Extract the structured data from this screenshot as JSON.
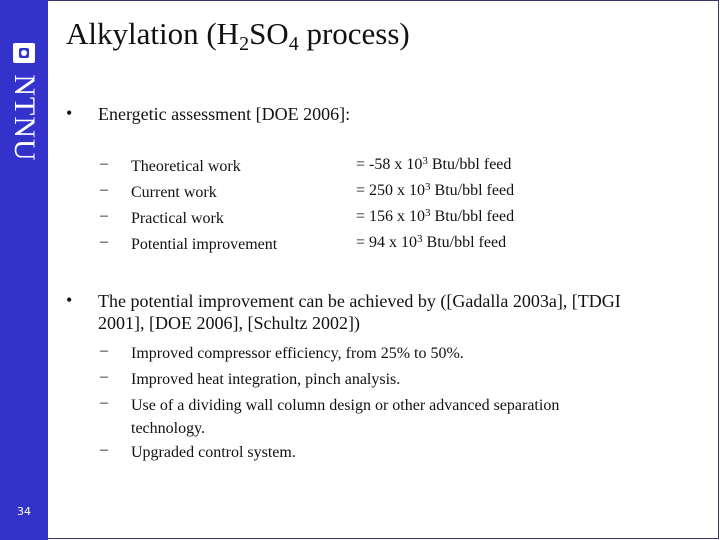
{
  "sidebar": {
    "logo_text": "NTNU",
    "logo_icon": "ntnu-square-logo-icon",
    "page_number": "34",
    "color": "#3333cc"
  },
  "title": {
    "prefix": "Alkylation (H",
    "sub1": "2",
    "mid": "SO",
    "sub2": "4",
    "suffix": " process)"
  },
  "bullets": [
    {
      "marker": "•",
      "text": "Energetic assessment [DOE 2006]:",
      "subitems": [
        {
          "marker": "–",
          "label": "Theoretical work",
          "value_prefix": "= -58 x 10",
          "exp": "3",
          "value_suffix": " Btu/bbl feed"
        },
        {
          "marker": "–",
          "label": "Current work",
          "value_prefix": "= 250 x 10",
          "exp": "3",
          "value_suffix": " Btu/bbl feed"
        },
        {
          "marker": "–",
          "label": "Practical work",
          "value_prefix": "= 156 x 10",
          "exp": "3",
          "value_suffix": " Btu/bbl feed"
        },
        {
          "marker": "–",
          "label": "Potential improvement",
          "value_prefix": "= 94 x 10",
          "exp": "3",
          "value_suffix": " Btu/bbl feed"
        }
      ]
    },
    {
      "marker": "•",
      "text": "The potential improvement can be achieved by ([Gadalla 2003a], [TDGI 2001], [DOE 2006], [Schultz 2002])",
      "subitems": [
        {
          "marker": "–",
          "label": "Improved compressor efficiency, from 25% to 50%."
        },
        {
          "marker": "–",
          "label": "Improved heat integration, pinch analysis."
        },
        {
          "marker": "–",
          "label": "Use of a dividing wall column design or other advanced separation technology."
        },
        {
          "marker": "–",
          "label": "Upgraded control system."
        }
      ]
    }
  ]
}
